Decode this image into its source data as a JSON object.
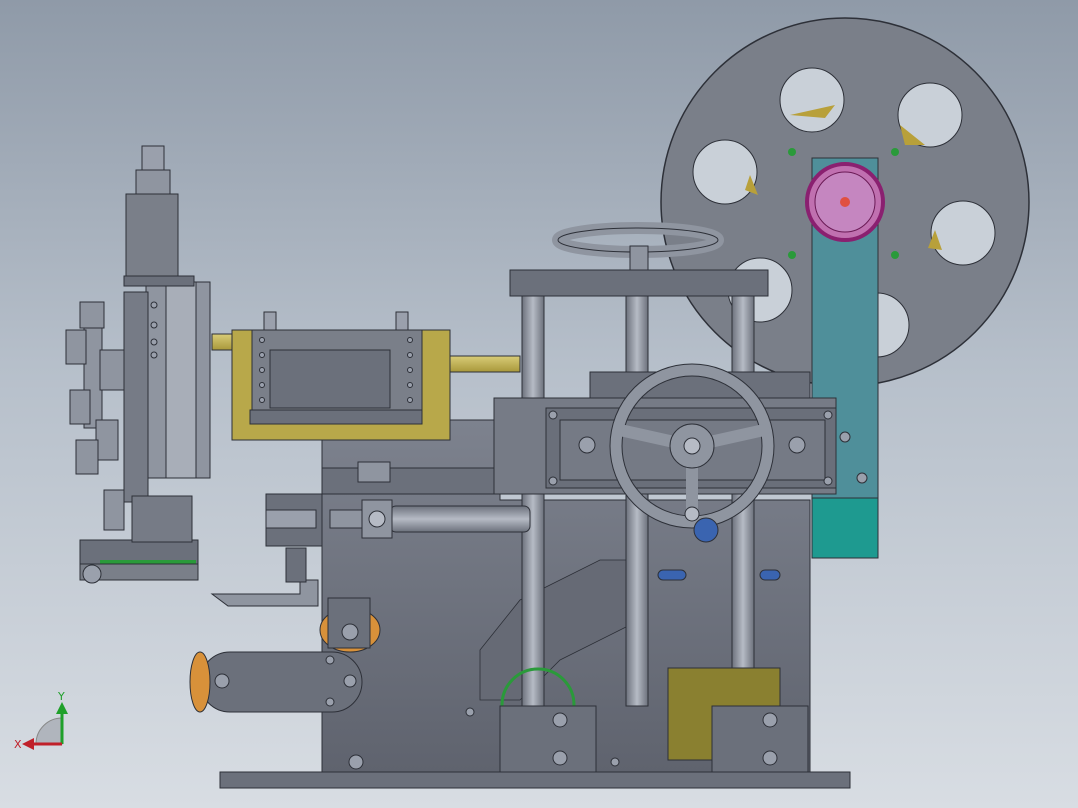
{
  "triad": {
    "x_label": "X",
    "y_label": "Y"
  },
  "colors": {
    "steel": "#6e7380",
    "steel_dark": "#4a4e58",
    "steel_light": "#9aa0ac",
    "brass": "#b8a84a",
    "teal": "#2aa39a",
    "teal_blue": "#4f8f9a",
    "magenta": "#c0399a",
    "green": "#2a9a3a",
    "orange": "#d8913a"
  }
}
